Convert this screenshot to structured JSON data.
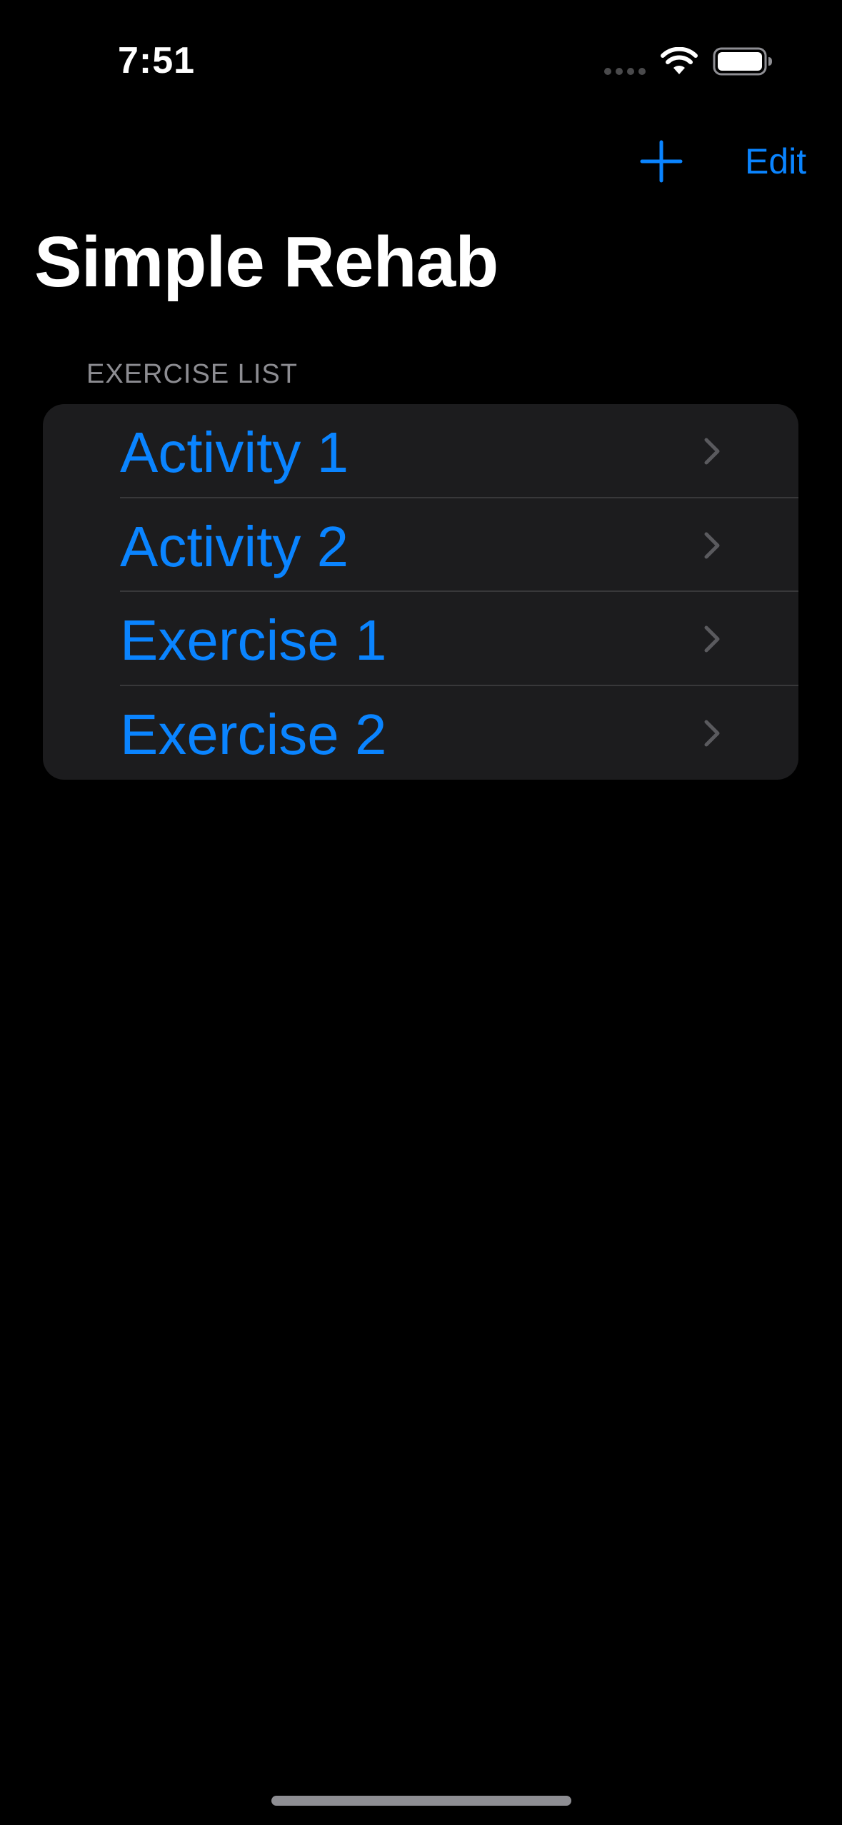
{
  "status_bar": {
    "time": "7:51",
    "icons": [
      "cellular-signal-icon",
      "wifi-icon",
      "battery-icon"
    ]
  },
  "nav": {
    "add_icon": "plus-icon",
    "edit_label": "Edit"
  },
  "page": {
    "title": "Simple Rehab"
  },
  "exercise_list": {
    "header": "EXERCISE LIST",
    "items": [
      {
        "label": "Activity 1"
      },
      {
        "label": "Activity 2"
      },
      {
        "label": "Exercise 1"
      },
      {
        "label": "Exercise 2"
      }
    ]
  },
  "colors": {
    "accent": "#0a84ff",
    "background": "#000000",
    "card": "#1c1c1e",
    "secondary_text": "#8d8d92"
  }
}
